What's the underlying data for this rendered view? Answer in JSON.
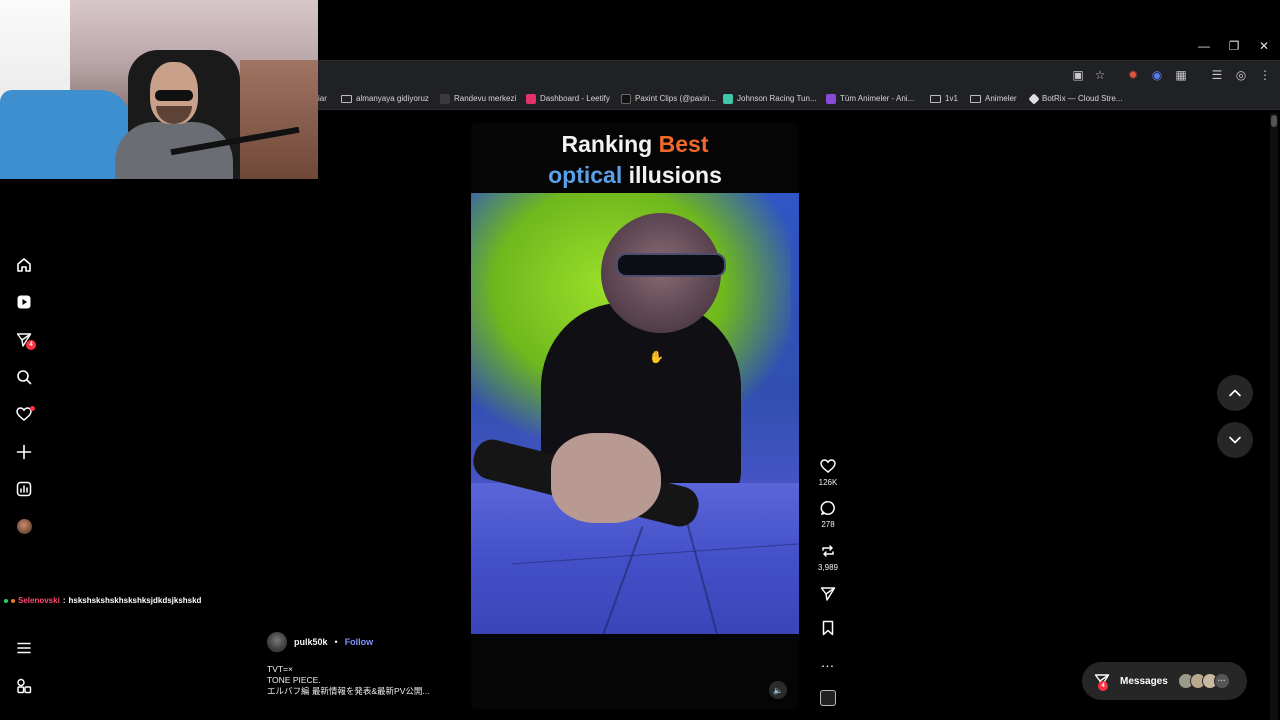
{
  "bookmarks": [
    {
      "label": "iar",
      "icon": "folder-icon"
    },
    {
      "label": "almanyaya gidiyoruz",
      "icon": "folder-icon"
    },
    {
      "label": "Randevu merkezi",
      "icon": "site-icon"
    },
    {
      "label": "Dashboard - Leetify",
      "icon": "site-icon"
    },
    {
      "label": "Paxint Clips (@paxin...",
      "icon": "tiktok-icon"
    },
    {
      "label": "Johnson Racing Tun...",
      "icon": "site-icon"
    },
    {
      "label": "Tüm Animeler - Ani...",
      "icon": "site-icon"
    },
    {
      "label": "1v1",
      "icon": "folder-icon"
    },
    {
      "label": "Animeler",
      "icon": "folder-icon"
    },
    {
      "label": "BotRix — Cloud Stre...",
      "icon": "site-icon"
    }
  ],
  "left_nav": {
    "messages_badge": "4"
  },
  "chat": {
    "user": "Selenovski",
    "separator": ":",
    "message": "hskshskshskhskshksjdkdsjkshskd"
  },
  "reel": {
    "title_line1_word1": "Ranking",
    "title_line1_word2": "Best",
    "title_line2_word1": "optical",
    "title_line2_word2": "illusions",
    "likes": "126K",
    "comments": "278",
    "reposts": "3,989"
  },
  "author": {
    "username": "pulk50k",
    "dot": "•",
    "follow_label": "Follow"
  },
  "caption": {
    "line1": "TVT=×",
    "line2": "TONE PIECE.",
    "line3": "エルバフ編 最新情報を発表&最新PV公開..."
  },
  "messages_widget": {
    "label": "Messages",
    "badge": "4"
  },
  "colors": {
    "accent_red": "#ff3040",
    "follow_blue": "#7f93ff",
    "title_orange": "#f0682a",
    "title_blue": "#5aa0e8"
  }
}
